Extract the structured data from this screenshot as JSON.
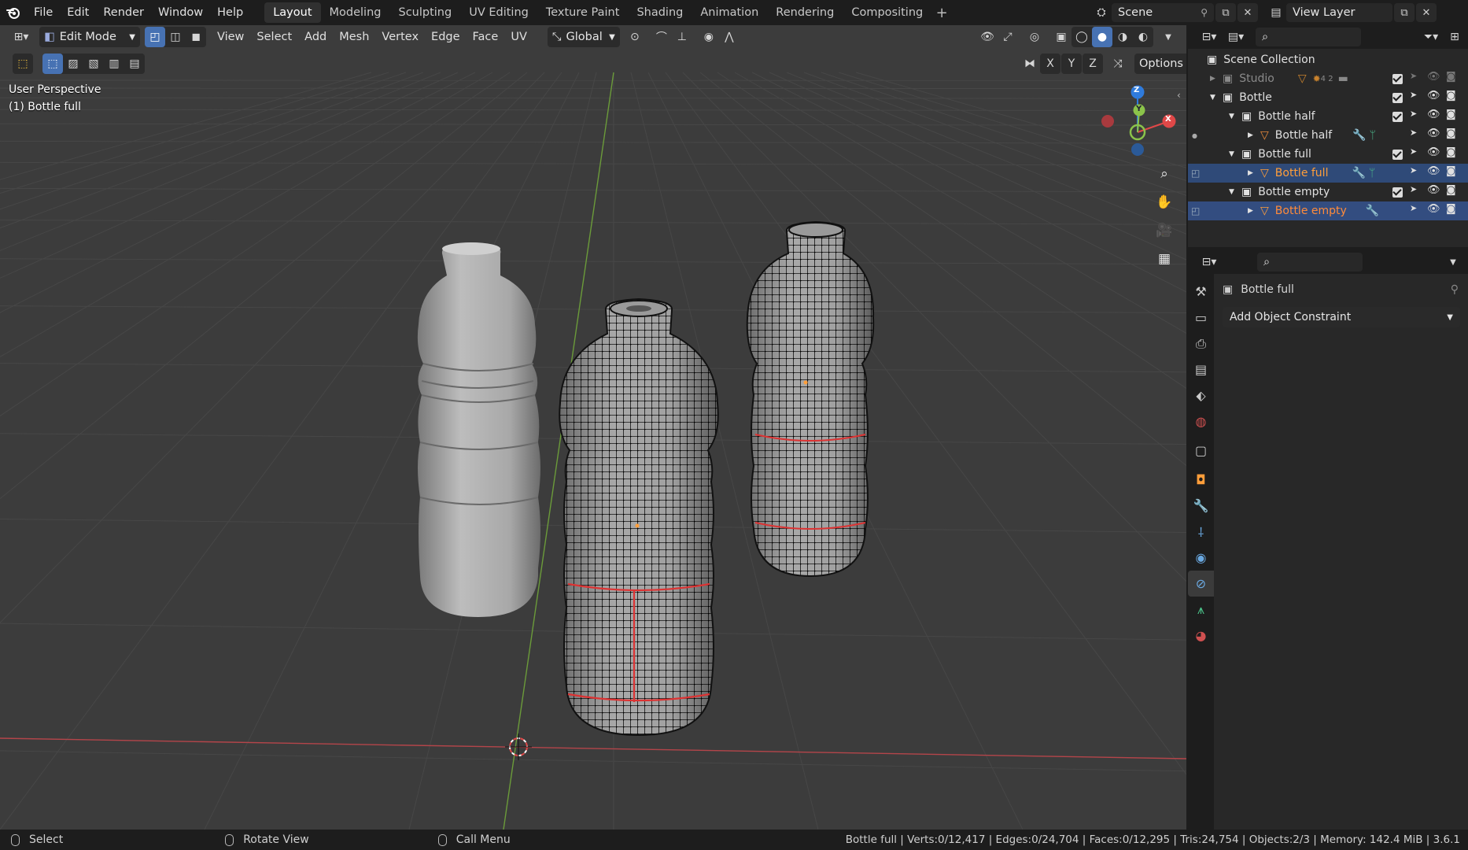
{
  "menubar": {
    "items": [
      "File",
      "Edit",
      "Render",
      "Window",
      "Help"
    ],
    "workspaces": [
      "Layout",
      "Modeling",
      "Sculpting",
      "UV Editing",
      "Texture Paint",
      "Shading",
      "Animation",
      "Rendering",
      "Compositing"
    ],
    "active_workspace": "Layout",
    "scene_name": "Scene",
    "view_layer_name": "View Layer"
  },
  "viewport_header": {
    "mode": "Edit Mode",
    "menus": [
      "View",
      "Select",
      "Add",
      "Mesh",
      "Vertex",
      "Edge",
      "Face",
      "UV"
    ],
    "transform_orientation": "Global",
    "axis_labels": [
      "X",
      "Y",
      "Z"
    ],
    "options_label": "Options"
  },
  "viewport": {
    "view_name": "User Perspective",
    "object_info": "(1) Bottle full",
    "gizmo": {
      "x": "X",
      "y": "Y",
      "z": "Z"
    }
  },
  "outliner": {
    "scene_collection": "Scene Collection",
    "rows": [
      {
        "name": "Studio",
        "kind": "collection",
        "indent": 0,
        "extra": "4  2"
      },
      {
        "name": "Bottle",
        "kind": "collection",
        "indent": 0
      },
      {
        "name": "Bottle half",
        "kind": "collection",
        "indent": 1
      },
      {
        "name": "Bottle half",
        "kind": "object",
        "indent": 2
      },
      {
        "name": "Bottle full",
        "kind": "collection",
        "indent": 1
      },
      {
        "name": "Bottle full",
        "kind": "object",
        "indent": 2
      },
      {
        "name": "Bottle empty",
        "kind": "collection",
        "indent": 1
      },
      {
        "name": "Bottle empty",
        "kind": "object",
        "indent": 2
      }
    ]
  },
  "properties": {
    "object_name": "Bottle full",
    "add_constraint_label": "Add Object Constraint"
  },
  "statusbar": {
    "select": "Select",
    "rotate": "Rotate View",
    "call_menu": "Call Menu",
    "stats": "Bottle full | Verts:0/12,417 | Edges:0/24,704 | Faces:0/12,295 | Tris:24,754 | Objects:2/3 | Memory: 142.4 MiB | 3.6.1"
  },
  "colors": {
    "accent_blue": "#4772b3",
    "active_object_orange": "#ff9e3a",
    "axis_x_red": "#e04848",
    "axis_y_green": "#8bc34a",
    "axis_z_blue": "#2f7bdc",
    "viewport_bg": "#3c3c3c"
  }
}
